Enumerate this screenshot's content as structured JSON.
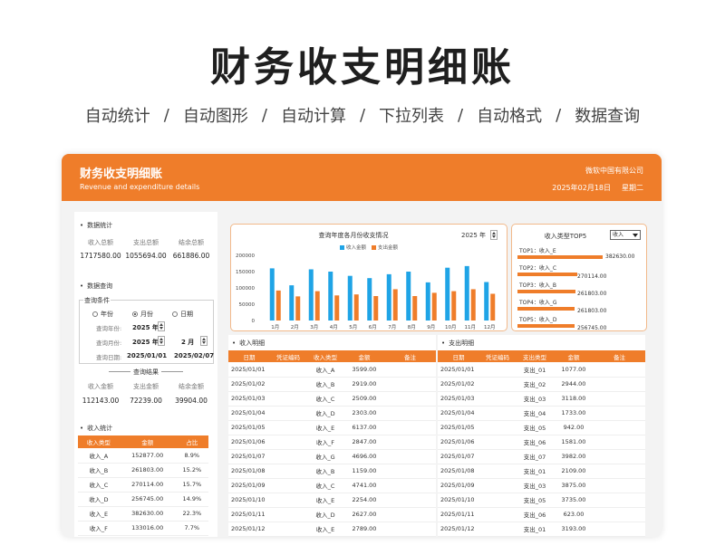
{
  "hero": {
    "title": "财务收支明细账",
    "features": [
      "自动统计",
      "自动图形",
      "自动计算",
      "下拉列表",
      "自动格式",
      "数据查询"
    ],
    "separator": "/"
  },
  "header": {
    "title": "财务收支明细账",
    "subtitle": "Revenue and expenditure details",
    "company": "微软中国有限公司",
    "date": "2025年02月18日",
    "weekday": "星期二",
    "accent_color": "#ef7d2a"
  },
  "stats": {
    "title": "数据统计",
    "headers": [
      "收入总额",
      "支出总额",
      "结余总额"
    ],
    "values": [
      "1717580.00",
      "1055694.00",
      "661886.00"
    ]
  },
  "query": {
    "title": "数据查询",
    "legend": "查询条件",
    "options": [
      "年份",
      "月份",
      "日期"
    ],
    "selected": "月份",
    "year_label": "查询年份:",
    "year_value": "2025 年",
    "month_label": "查询月份:",
    "month_year": "2025 年",
    "month_value": "2 月",
    "date_label": "查询日期:",
    "date_from": "2025/01/01",
    "date_to": "2025/02/07",
    "result_title": "查询结果",
    "result_headers": [
      "收入金额",
      "支出金额",
      "结余金额"
    ],
    "result_values": [
      "112143.00",
      "72239.00",
      "39904.00"
    ]
  },
  "income_stats": {
    "title": "收入统计",
    "headers": [
      "收入类型",
      "金额",
      "占比"
    ],
    "rows": [
      [
        "收入_A",
        "152877.00",
        "8.9%"
      ],
      [
        "收入_B",
        "261803.00",
        "15.2%"
      ],
      [
        "收入_C",
        "270114.00",
        "15.7%"
      ],
      [
        "收入_D",
        "256745.00",
        "14.9%"
      ],
      [
        "收入_E",
        "382630.00",
        "22.3%"
      ],
      [
        "收入_F",
        "133016.00",
        "7.7%"
      ]
    ]
  },
  "chart": {
    "title": "查询年度各月份收支情况",
    "year_value": "2025 年",
    "income_color": "#1fa4e6",
    "expense_color": "#ef7d2a"
  },
  "chart_data": {
    "type": "bar",
    "title": "查询年度各月份收支情况",
    "categories": [
      "1月",
      "2月",
      "3月",
      "4月",
      "5月",
      "6月",
      "7月",
      "8月",
      "9月",
      "10月",
      "11月",
      "12月"
    ],
    "series": [
      {
        "name": "收入金额",
        "values": [
          160000,
          108000,
          157000,
          150000,
          137000,
          130000,
          142000,
          150000,
          117000,
          162000,
          167000,
          118000
        ]
      },
      {
        "name": "支出金额",
        "values": [
          92000,
          74000,
          90000,
          77000,
          80000,
          75000,
          96000,
          75000,
          85000,
          90000,
          96000,
          82000
        ]
      }
    ],
    "yticks": [
      0,
      50000,
      100000,
      150000,
      200000
    ],
    "ylim": [
      0,
      200000
    ],
    "legend": "top"
  },
  "top5": {
    "title": "收入类型TOP5",
    "select_value": "收入",
    "items": [
      {
        "label": "TOP1：收入_E",
        "value": 382630,
        "value_text": "382630.00"
      },
      {
        "label": "TOP2：收入_C",
        "value": 270114,
        "value_text": "270114.00"
      },
      {
        "label": "TOP3：收入_B",
        "value": 261803,
        "value_text": "261803.00"
      },
      {
        "label": "TOP4：收入_G",
        "value": 256745,
        "value_text": "261803.00"
      },
      {
        "label": "TOP5：收入_D",
        "value": 256745,
        "value_text": "256745.00"
      }
    ]
  },
  "income_detail": {
    "title": "收入明细",
    "headers": [
      "日期",
      "凭证编码",
      "收入类型",
      "金额",
      "备注"
    ],
    "rows": [
      [
        "2025/01/01",
        "",
        "收入_A",
        "3599.00",
        ""
      ],
      [
        "2025/01/02",
        "",
        "收入_B",
        "2919.00",
        ""
      ],
      [
        "2025/01/03",
        "",
        "收入_C",
        "2509.00",
        ""
      ],
      [
        "2025/01/04",
        "",
        "收入_D",
        "2303.00",
        ""
      ],
      [
        "2025/01/05",
        "",
        "收入_E",
        "6137.00",
        ""
      ],
      [
        "2025/01/06",
        "",
        "收入_F",
        "2847.00",
        ""
      ],
      [
        "2025/01/07",
        "",
        "收入_G",
        "4696.00",
        ""
      ],
      [
        "2025/01/08",
        "",
        "收入_B",
        "1159.00",
        ""
      ],
      [
        "2025/01/09",
        "",
        "收入_C",
        "4741.00",
        ""
      ],
      [
        "2025/01/10",
        "",
        "收入_E",
        "2254.00",
        ""
      ],
      [
        "2025/01/11",
        "",
        "收入_D",
        "2627.00",
        ""
      ],
      [
        "2025/01/12",
        "",
        "收入_E",
        "2789.00",
        ""
      ]
    ]
  },
  "expense_detail": {
    "title": "支出明细",
    "headers": [
      "日期",
      "凭证编码",
      "支出类型",
      "金额",
      "备注"
    ],
    "rows": [
      [
        "2025/01/01",
        "",
        "支出_01",
        "1077.00",
        ""
      ],
      [
        "2025/01/02",
        "",
        "支出_02",
        "2944.00",
        ""
      ],
      [
        "2025/01/03",
        "",
        "支出_03",
        "3118.00",
        ""
      ],
      [
        "2025/01/04",
        "",
        "支出_04",
        "1733.00",
        ""
      ],
      [
        "2025/01/05",
        "",
        "支出_05",
        "942.00",
        ""
      ],
      [
        "2025/01/06",
        "",
        "支出_06",
        "1581.00",
        ""
      ],
      [
        "2025/01/07",
        "",
        "支出_07",
        "3982.00",
        ""
      ],
      [
        "2025/01/08",
        "",
        "支出_01",
        "2109.00",
        ""
      ],
      [
        "2025/01/09",
        "",
        "支出_03",
        "3875.00",
        ""
      ],
      [
        "2025/01/10",
        "",
        "支出_05",
        "3735.00",
        ""
      ],
      [
        "2025/01/11",
        "",
        "支出_06",
        "623.00",
        ""
      ],
      [
        "2025/01/12",
        "",
        "支出_01",
        "3193.00",
        ""
      ]
    ]
  }
}
